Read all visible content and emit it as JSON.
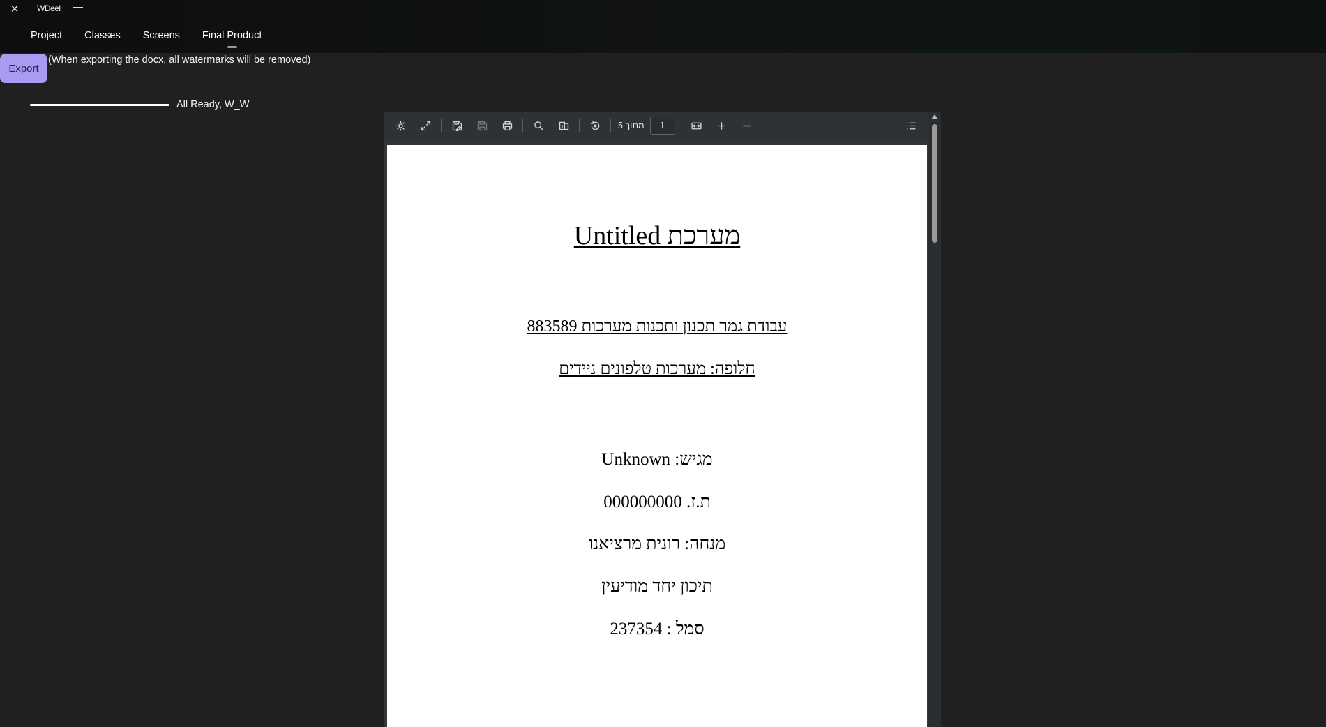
{
  "window": {
    "title": "WDeel",
    "close_glyph": "✕",
    "minimize_glyph": "—"
  },
  "nav": {
    "tabs": [
      {
        "label": "Project"
      },
      {
        "label": "Classes"
      },
      {
        "label": "Screens"
      },
      {
        "label": "Final Product",
        "active": true
      }
    ]
  },
  "export": {
    "button_label": "Export",
    "note": "(When exporting the docx, all watermarks will be removed)",
    "accent_color": "#a99bf1"
  },
  "progress": {
    "fraction": 1.0,
    "status": "All Ready, W_W"
  },
  "pdf_viewer": {
    "toolbar": {
      "icons": [
        "settings-icon",
        "fullscreen-icon",
        "save-as-icon",
        "save-icon",
        "print-icon",
        "search-icon",
        "page-view-icon",
        "rotate-icon",
        "fit-width-icon",
        "zoom-in-icon",
        "zoom-out-icon",
        "outline-icon"
      ],
      "page_of_label": "מתוך 5",
      "current_page": "1"
    },
    "page": {
      "title": "מערכת Untitled",
      "subtitle_1": "עבודת גמר תכנון ותכנות מערכות 883589",
      "subtitle_2": "חלופה: מערכות טלפונים ניידים",
      "submitter": "מגיש: Unknown",
      "id_line": "ת.ז. 000000000",
      "mentor": "מנחה: רונית מרציאנו",
      "school": "תיכון יחד מודיעין",
      "school_code": "סמל : 237354"
    }
  }
}
